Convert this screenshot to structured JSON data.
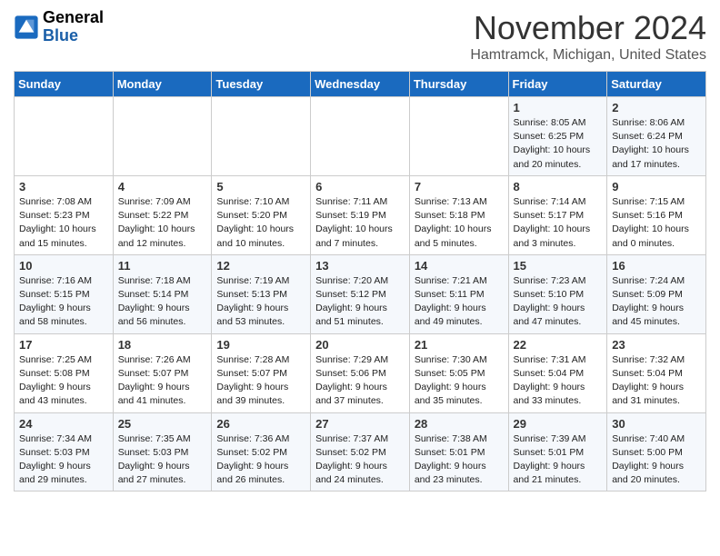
{
  "header": {
    "logo_general": "General",
    "logo_blue": "Blue",
    "month_title": "November 2024",
    "location": "Hamtramck, Michigan, United States"
  },
  "days_of_week": [
    "Sunday",
    "Monday",
    "Tuesday",
    "Wednesday",
    "Thursday",
    "Friday",
    "Saturday"
  ],
  "weeks": [
    [
      {
        "day": "",
        "info": ""
      },
      {
        "day": "",
        "info": ""
      },
      {
        "day": "",
        "info": ""
      },
      {
        "day": "",
        "info": ""
      },
      {
        "day": "",
        "info": ""
      },
      {
        "day": "1",
        "info": "Sunrise: 8:05 AM\nSunset: 6:25 PM\nDaylight: 10 hours and 20 minutes."
      },
      {
        "day": "2",
        "info": "Sunrise: 8:06 AM\nSunset: 6:24 PM\nDaylight: 10 hours and 17 minutes."
      }
    ],
    [
      {
        "day": "3",
        "info": "Sunrise: 7:08 AM\nSunset: 5:23 PM\nDaylight: 10 hours and 15 minutes."
      },
      {
        "day": "4",
        "info": "Sunrise: 7:09 AM\nSunset: 5:22 PM\nDaylight: 10 hours and 12 minutes."
      },
      {
        "day": "5",
        "info": "Sunrise: 7:10 AM\nSunset: 5:20 PM\nDaylight: 10 hours and 10 minutes."
      },
      {
        "day": "6",
        "info": "Sunrise: 7:11 AM\nSunset: 5:19 PM\nDaylight: 10 hours and 7 minutes."
      },
      {
        "day": "7",
        "info": "Sunrise: 7:13 AM\nSunset: 5:18 PM\nDaylight: 10 hours and 5 minutes."
      },
      {
        "day": "8",
        "info": "Sunrise: 7:14 AM\nSunset: 5:17 PM\nDaylight: 10 hours and 3 minutes."
      },
      {
        "day": "9",
        "info": "Sunrise: 7:15 AM\nSunset: 5:16 PM\nDaylight: 10 hours and 0 minutes."
      }
    ],
    [
      {
        "day": "10",
        "info": "Sunrise: 7:16 AM\nSunset: 5:15 PM\nDaylight: 9 hours and 58 minutes."
      },
      {
        "day": "11",
        "info": "Sunrise: 7:18 AM\nSunset: 5:14 PM\nDaylight: 9 hours and 56 minutes."
      },
      {
        "day": "12",
        "info": "Sunrise: 7:19 AM\nSunset: 5:13 PM\nDaylight: 9 hours and 53 minutes."
      },
      {
        "day": "13",
        "info": "Sunrise: 7:20 AM\nSunset: 5:12 PM\nDaylight: 9 hours and 51 minutes."
      },
      {
        "day": "14",
        "info": "Sunrise: 7:21 AM\nSunset: 5:11 PM\nDaylight: 9 hours and 49 minutes."
      },
      {
        "day": "15",
        "info": "Sunrise: 7:23 AM\nSunset: 5:10 PM\nDaylight: 9 hours and 47 minutes."
      },
      {
        "day": "16",
        "info": "Sunrise: 7:24 AM\nSunset: 5:09 PM\nDaylight: 9 hours and 45 minutes."
      }
    ],
    [
      {
        "day": "17",
        "info": "Sunrise: 7:25 AM\nSunset: 5:08 PM\nDaylight: 9 hours and 43 minutes."
      },
      {
        "day": "18",
        "info": "Sunrise: 7:26 AM\nSunset: 5:07 PM\nDaylight: 9 hours and 41 minutes."
      },
      {
        "day": "19",
        "info": "Sunrise: 7:28 AM\nSunset: 5:07 PM\nDaylight: 9 hours and 39 minutes."
      },
      {
        "day": "20",
        "info": "Sunrise: 7:29 AM\nSunset: 5:06 PM\nDaylight: 9 hours and 37 minutes."
      },
      {
        "day": "21",
        "info": "Sunrise: 7:30 AM\nSunset: 5:05 PM\nDaylight: 9 hours and 35 minutes."
      },
      {
        "day": "22",
        "info": "Sunrise: 7:31 AM\nSunset: 5:04 PM\nDaylight: 9 hours and 33 minutes."
      },
      {
        "day": "23",
        "info": "Sunrise: 7:32 AM\nSunset: 5:04 PM\nDaylight: 9 hours and 31 minutes."
      }
    ],
    [
      {
        "day": "24",
        "info": "Sunrise: 7:34 AM\nSunset: 5:03 PM\nDaylight: 9 hours and 29 minutes."
      },
      {
        "day": "25",
        "info": "Sunrise: 7:35 AM\nSunset: 5:03 PM\nDaylight: 9 hours and 27 minutes."
      },
      {
        "day": "26",
        "info": "Sunrise: 7:36 AM\nSunset: 5:02 PM\nDaylight: 9 hours and 26 minutes."
      },
      {
        "day": "27",
        "info": "Sunrise: 7:37 AM\nSunset: 5:02 PM\nDaylight: 9 hours and 24 minutes."
      },
      {
        "day": "28",
        "info": "Sunrise: 7:38 AM\nSunset: 5:01 PM\nDaylight: 9 hours and 23 minutes."
      },
      {
        "day": "29",
        "info": "Sunrise: 7:39 AM\nSunset: 5:01 PM\nDaylight: 9 hours and 21 minutes."
      },
      {
        "day": "30",
        "info": "Sunrise: 7:40 AM\nSunset: 5:00 PM\nDaylight: 9 hours and 20 minutes."
      }
    ]
  ]
}
